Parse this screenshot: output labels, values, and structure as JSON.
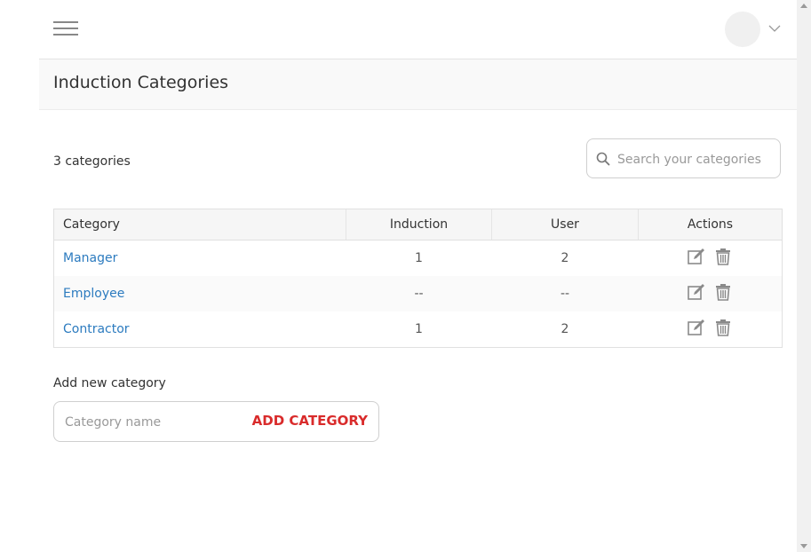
{
  "header": {
    "menu_icon": "hamburger-icon",
    "avatar_icon": "avatar",
    "dropdown_icon": "chevron-down-icon"
  },
  "page": {
    "title": "Induction Categories",
    "count_text": "3 categories"
  },
  "search": {
    "placeholder": "Search your categories",
    "value": "",
    "icon": "search-icon"
  },
  "table": {
    "columns": [
      "Category",
      "Induction",
      "User",
      "Actions"
    ],
    "rows": [
      {
        "category": "Manager",
        "induction": "1",
        "user": "2"
      },
      {
        "category": "Employee",
        "induction": "--",
        "user": "--"
      },
      {
        "category": "Contractor",
        "induction": "1",
        "user": "2"
      }
    ],
    "action_icons": [
      "edit-icon",
      "trash-icon"
    ]
  },
  "add_category": {
    "label": "Add new category",
    "placeholder": "Category name",
    "value": "",
    "button_label": "ADD CATEGORY"
  },
  "colors": {
    "link": "#2c7bbf",
    "add_button": "#d92b2b",
    "header_bg": "#f6f6f6"
  }
}
